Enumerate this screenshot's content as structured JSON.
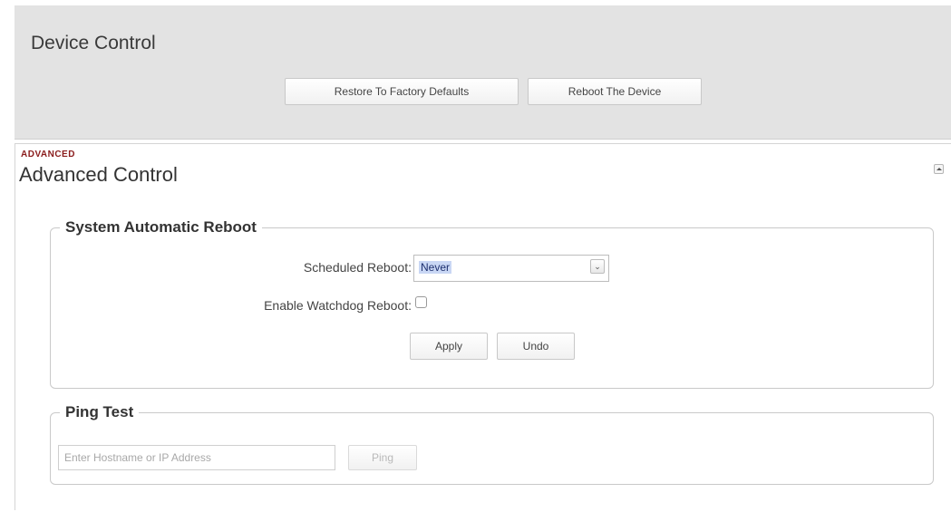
{
  "device_control": {
    "title": "Device Control",
    "restore_label": "Restore To Factory Defaults",
    "reboot_label": "Reboot The Device"
  },
  "advanced": {
    "tag": "ADVANCED",
    "title": "Advanced Control",
    "collapse_icon": "collapse-up-icon"
  },
  "auto_reboot": {
    "legend": "System Automatic Reboot",
    "scheduled_label": "Scheduled Reboot:",
    "scheduled_value": "Never",
    "watchdog_label": "Enable Watchdog Reboot:",
    "watchdog_checked": false,
    "apply_label": "Apply",
    "undo_label": "Undo"
  },
  "ping_test": {
    "legend": "Ping Test",
    "placeholder": "Enter Hostname or IP Address",
    "ping_label": "Ping"
  }
}
